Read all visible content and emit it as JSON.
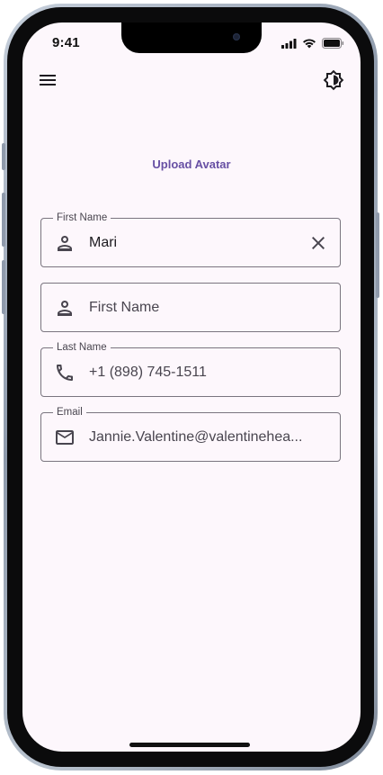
{
  "status": {
    "time": "9:41",
    "signal_icon": "cellular-signal-icon",
    "wifi_icon": "wifi-icon",
    "battery_icon": "battery-icon"
  },
  "toolbar": {
    "menu_icon": "menu-icon",
    "theme_icon": "brightness-icon"
  },
  "upload_avatar": "Upload Avatar",
  "fields": [
    {
      "label": "First Name",
      "value": "Mari",
      "placeholder": "",
      "icon": "person-icon",
      "clearable": true
    },
    {
      "label": "",
      "value": "",
      "placeholder": "First Name",
      "icon": "person-icon",
      "clearable": false
    },
    {
      "label": "Last Name",
      "value": "+1 (898) 745-1511",
      "placeholder": "",
      "icon": "phone-icon",
      "clearable": false
    },
    {
      "label": "Email",
      "value": "Jannie.Valentine@valentinehea...",
      "placeholder": "",
      "icon": "mail-icon",
      "clearable": false
    }
  ],
  "colors": {
    "accent": "#6750a4",
    "background": "#fdf7fc",
    "outline": "#7a757f"
  }
}
